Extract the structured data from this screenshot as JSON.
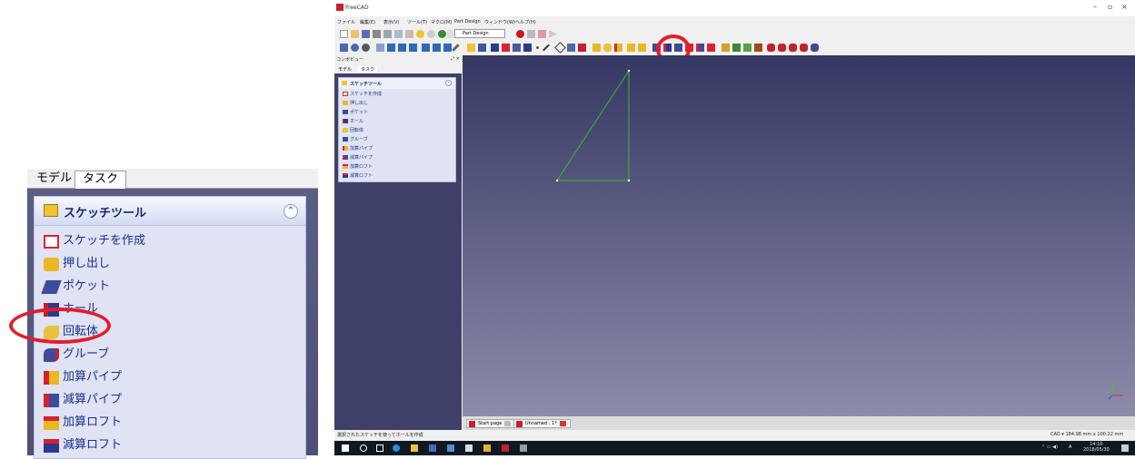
{
  "zoom_panel": {
    "tabs": [
      "モデル",
      "タスク"
    ],
    "section_title": "スケッチツール",
    "collapse_glyph": "⌃",
    "items": [
      {
        "label": "スケッチを作成",
        "icon": "sketch-icon"
      },
      {
        "label": "押し出し",
        "icon": "pad-icon"
      },
      {
        "label": "ポケット",
        "icon": "pocket-icon"
      },
      {
        "label": "ホール",
        "icon": "hole-icon"
      },
      {
        "label": "回転体",
        "icon": "revolution-icon"
      },
      {
        "label": "グルーブ",
        "icon": "groove-icon"
      },
      {
        "label": "加算パイプ",
        "icon": "additive-pipe-icon"
      },
      {
        "label": "減算パイプ",
        "icon": "subtractive-pipe-icon"
      },
      {
        "label": "加算ロフト",
        "icon": "additive-loft-icon"
      },
      {
        "label": "減算ロフト",
        "icon": "subtractive-loft-icon"
      }
    ],
    "highlighted_item": "回転体"
  },
  "window": {
    "title": "FreeCAD",
    "menu": [
      "ファイル",
      "編集(E)",
      "表示(V)",
      "ツール(T)",
      "マクロ(M)",
      "Part Design",
      "ウィンドウ(W)",
      "ヘルプ(H)"
    ],
    "workbench": "Part Design",
    "combo_view": {
      "title": "コンボビュー",
      "tabs": [
        "モデル",
        "タスク"
      ],
      "section_title": "スケッチツール",
      "items": [
        "スケッチを作成",
        "押し出し",
        "ポケット",
        "ホール",
        "回転体",
        "グルーブ",
        "加算パイプ",
        "減算パイプ",
        "加算ロフト",
        "減算ロフト"
      ]
    },
    "doc_tabs": [
      "Start page",
      "Unnamed : 1*"
    ],
    "status_left": "選択されたスケッチを使ってホールを作成",
    "status_right": "CAD ▾   184.98 mm x 100.22 mm",
    "taskbar_time": "14:10",
    "taskbar_date": "2018/05/30",
    "taskbar_ime": "A",
    "colors": {
      "highlight_circle": "#e21e2a",
      "sketch_line": "#2fbf2f",
      "viewport_top": "#353763",
      "viewport_bottom": "#8c8caa"
    }
  }
}
